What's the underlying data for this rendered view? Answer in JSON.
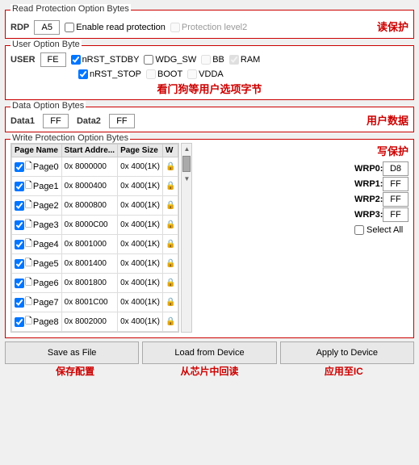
{
  "readProtection": {
    "label": "Read Protection Option Bytes",
    "rdpLabel": "RDP",
    "rdpValue": "A5",
    "enableReadProt": "Enable read protection",
    "enableChecked": false,
    "protectionLevel2": "Protection level2",
    "protLevel2Checked": false,
    "annotation": "读保护"
  },
  "userOptionByte": {
    "label": "User Option Byte",
    "userLabel": "USER",
    "userValue": "FE",
    "row1": [
      {
        "id": "nRST_STDBY",
        "label": "nRST_STDBY",
        "checked": true
      },
      {
        "id": "WDG_SW",
        "label": "WDG_SW",
        "checked": false
      },
      {
        "id": "BB",
        "label": "BB",
        "checked": false,
        "disabled": true
      },
      {
        "id": "RAM",
        "label": "RAM",
        "checked": true,
        "disabled": true
      }
    ],
    "row2": [
      {
        "id": "nRST_STOP",
        "label": "nRST_STOP",
        "checked": true
      },
      {
        "id": "BOOT",
        "label": "BOOT",
        "checked": false,
        "disabled": true
      },
      {
        "id": "VDDA",
        "label": "VDDA",
        "checked": false,
        "disabled": true
      }
    ],
    "annotation": "看门狗等用户选项字节"
  },
  "dataOptionBytes": {
    "label": "Data Option Bytes",
    "data1Label": "Data1",
    "data1Value": "FF",
    "data2Label": "Data2",
    "data2Value": "FF",
    "annotation": "用户数据"
  },
  "writeProtection": {
    "label": "Write Protection Option Bytes",
    "annotation": "写保护",
    "tableHeaders": [
      "Page Name",
      "Start Addre...",
      "Page Size",
      "W"
    ],
    "pages": [
      {
        "name": "Page0",
        "addr": "0x 8000000",
        "size": "0x 400(1K)",
        "checked": true
      },
      {
        "name": "Page1",
        "addr": "0x 8000400",
        "size": "0x 400(1K)",
        "checked": true
      },
      {
        "name": "Page2",
        "addr": "0x 8000800",
        "size": "0x 400(1K)",
        "checked": true
      },
      {
        "name": "Page3",
        "addr": "0x 8000C00",
        "size": "0x 400(1K)",
        "checked": true
      },
      {
        "name": "Page4",
        "addr": "0x 8001000",
        "size": "0x 400(1K)",
        "checked": true
      },
      {
        "name": "Page5",
        "addr": "0x 8001400",
        "size": "0x 400(1K)",
        "checked": true
      },
      {
        "name": "Page6",
        "addr": "0x 8001800",
        "size": "0x 400(1K)",
        "checked": true
      },
      {
        "name": "Page7",
        "addr": "0x 8001C00",
        "size": "0x 400(1K)",
        "checked": true
      },
      {
        "name": "Page8",
        "addr": "0x 8002000",
        "size": "0x 400(1K)",
        "checked": true
      }
    ],
    "wprFields": [
      {
        "label": "WRP0:",
        "value": "D8"
      },
      {
        "label": "WRP1:",
        "value": "FF"
      },
      {
        "label": "WRP2:",
        "value": "FF"
      },
      {
        "label": "WRP3:",
        "value": "FF"
      }
    ],
    "selectLabel": "Select",
    "selectAllLabel": "Select All",
    "selectAllChecked": false
  },
  "buttons": {
    "saveFile": "Save as File",
    "loadDevice": "Load from Device",
    "applyDevice": "Apply to Device"
  },
  "annotations": {
    "save": "保存配置",
    "load": "从芯片中回读",
    "apply": "应用至IC"
  }
}
